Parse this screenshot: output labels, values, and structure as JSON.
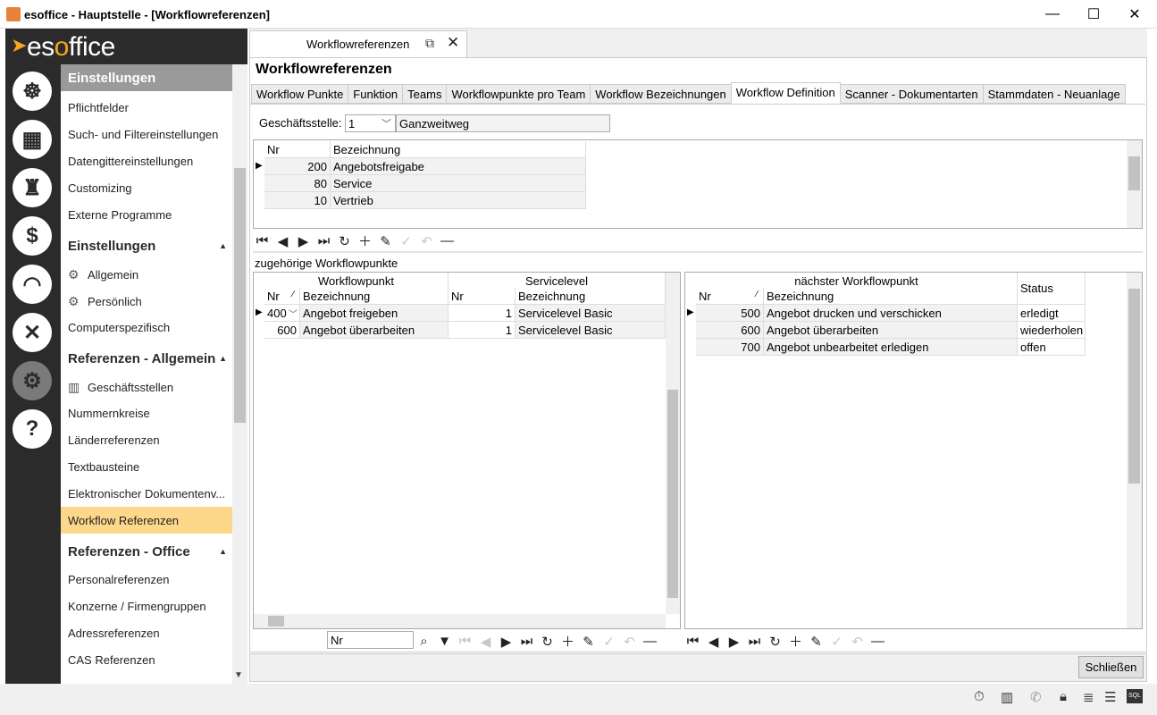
{
  "window": {
    "title": "esoffice - Hauptstelle - [Workflowreferenzen]",
    "controls": [
      "—",
      "☐",
      "✕"
    ]
  },
  "logo": {
    "text_es": "es",
    "text_o": "o",
    "text_rest": "ffice"
  },
  "rail_icons": [
    "ship-wheel-icon",
    "calculator-icon",
    "alarm-icon",
    "money-icon",
    "headset-icon",
    "tools-icon",
    "settings-icon",
    "help-icon"
  ],
  "nav": {
    "top_header": "Einstellungen",
    "items_top": [
      "Pflichtfelder",
      "Such- und Filtereinstellungen",
      "Datengittereinstellungen",
      "Customizing",
      "Externe Programme"
    ],
    "sec1": "Einstellungen",
    "sec1_items": [
      "Allgemein",
      "Persönlich",
      "Computerspezifisch"
    ],
    "sec2": "Referenzen - Allgemein",
    "sec2_items": [
      "Geschäftsstellen",
      "Nummernkreise",
      "Länderreferenzen",
      "Textbausteine",
      "Elektronischer Dokumentenv...",
      "Workflow Referenzen"
    ],
    "sec3": "Referenzen - Office",
    "sec3_items": [
      "Personalreferenzen",
      "Konzerne / Firmengruppen",
      "Adressreferenzen",
      "CAS Referenzen"
    ]
  },
  "doc_tab": {
    "label": "Workflowreferenzen"
  },
  "page_title": "Workflowreferenzen",
  "subtabs": [
    "Workflow Punkte",
    "Funktion",
    "Teams",
    "Workflowpunkte pro Team",
    "Workflow Bezeichnungen",
    "Workflow Definition",
    "Scanner - Dokumentarten",
    "Stammdaten - Neuanlage"
  ],
  "filter": {
    "label": "Geschäftsstelle:",
    "value": "1",
    "name": "Ganzweitweg"
  },
  "grid1": {
    "headers": [
      "Nr",
      "Bezeichnung"
    ],
    "rows": [
      [
        "200",
        "Angebotsfreigabe"
      ],
      [
        "80",
        "Service"
      ],
      [
        "10",
        "Vertrieb"
      ]
    ]
  },
  "section_label": "zugehörige Workflowpunkte",
  "grid2": {
    "group1": "Workflowpunkt",
    "group2": "Servicelevel",
    "headers": [
      "Nr",
      "Bezeichnung",
      "Nr",
      "Bezeichnung"
    ],
    "rows": [
      [
        "400",
        "Angebot freigeben",
        "1",
        "Servicelevel Basic"
      ],
      [
        "600",
        "Angebot überarbeiten",
        "1",
        "Servicelevel Basic"
      ]
    ]
  },
  "grid3": {
    "group1": "nächster Workflowpunkt",
    "status_header": "Status",
    "headers": [
      "Nr",
      "Bezeichnung"
    ],
    "rows": [
      [
        "500",
        "Angebot drucken und verschicken",
        "erledigt"
      ],
      [
        "600",
        "Angebot überarbeiten",
        "wiederholen"
      ],
      [
        "700",
        "Angebot unbearbeitet erledigen",
        "offen"
      ]
    ]
  },
  "search": {
    "value": "Nr"
  },
  "close_button": "Schließen",
  "status_icons": [
    "stopwatch-icon",
    "building-icon",
    "phone-icon",
    "lock-icon",
    "database-icon",
    "list-icon",
    "sql-icon"
  ]
}
